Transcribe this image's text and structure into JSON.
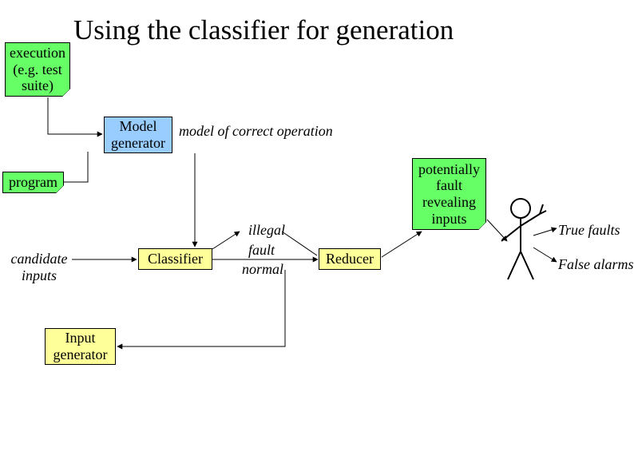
{
  "title": "Using the classifier for generation",
  "boxes": {
    "execution": "execution\n(e.g. test\nsuite)",
    "modelGenerator": "Model\ngenerator",
    "program": "program",
    "classifier": "Classifier",
    "reducer": "Reducer",
    "candidateInputs": "candidate\ninputs",
    "inputGenerator": "Input\ngenerator",
    "pfri": "potentially\nfault\nrevealing\ninputs"
  },
  "labels": {
    "modelCorrect": "model of correct operation",
    "illegal": "illegal",
    "fault": "fault",
    "normal": "normal",
    "trueFaults": "True faults",
    "falseAlarms": "False alarms"
  }
}
